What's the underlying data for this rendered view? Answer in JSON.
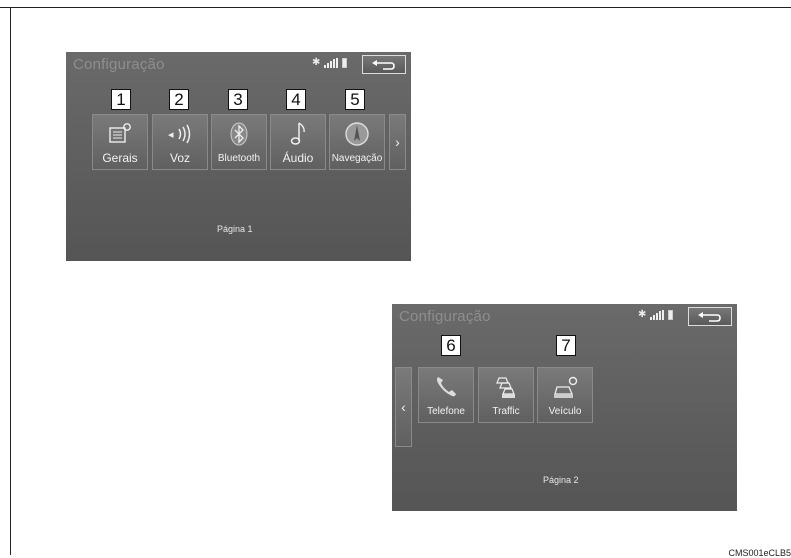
{
  "screen1": {
    "title": "Configuração",
    "page_label": "Página 1",
    "tiles": [
      {
        "label": "Gerais",
        "icon": "settings-doc-icon",
        "callout": "1"
      },
      {
        "label": "Voz",
        "icon": "voice-icon",
        "callout": "2"
      },
      {
        "label": "Bluetooth",
        "icon": "bluetooth-icon",
        "callout": "3"
      },
      {
        "label": "Áudio",
        "icon": "music-note-icon",
        "callout": "4"
      },
      {
        "label": "Navegação",
        "icon": "navigation-icon",
        "callout": "5"
      }
    ],
    "next_arrow": "›"
  },
  "screen2": {
    "title": "Configuração",
    "page_label": "Página 2",
    "tiles": [
      {
        "label": "Telefone",
        "icon": "phone-icon",
        "callout": "6"
      },
      {
        "label": "Traffic",
        "icon": "traffic-icon",
        "callout": ""
      },
      {
        "label": "Veículo",
        "icon": "vehicle-settings-icon",
        "callout": "7"
      }
    ],
    "prev_arrow": "‹"
  },
  "footer_code": "CMS001eCLB5",
  "colors": {
    "screen_bg": "#606060",
    "text_light": "#f2f2f2",
    "title_dim": "#8e8e8e"
  }
}
